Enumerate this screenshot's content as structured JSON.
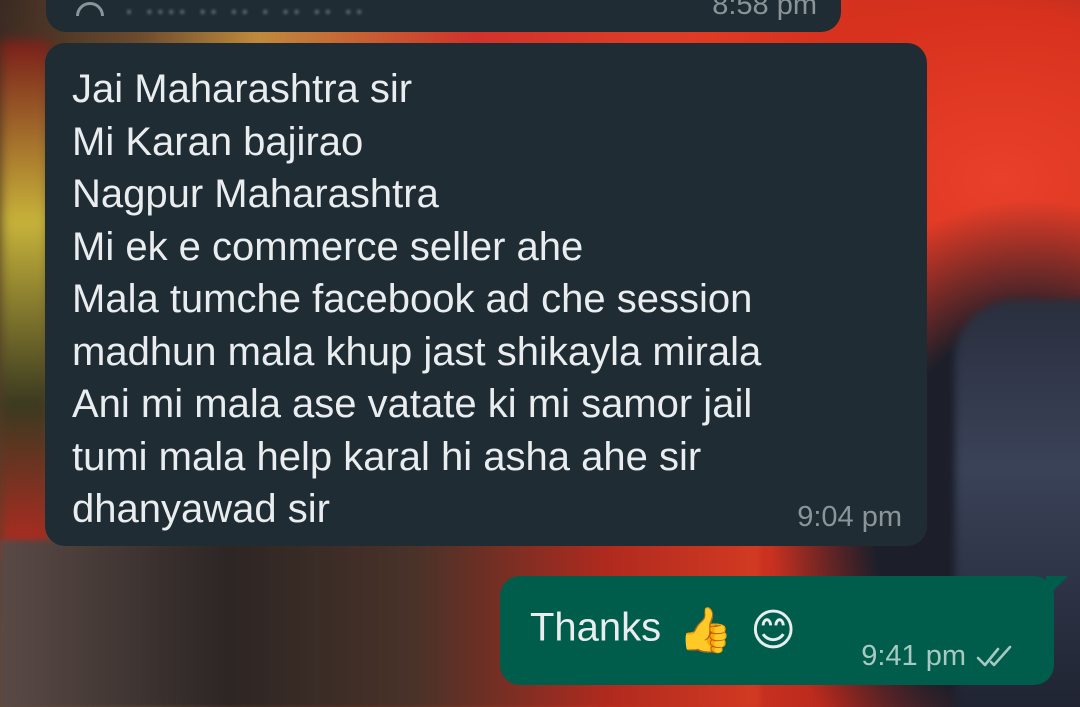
{
  "previous_message": {
    "partial_text": "·  ····  ·· ·· · ·· ·· ··",
    "time": "8:58 pm"
  },
  "incoming_message": {
    "lines": [
      "Jai Maharashtra sir",
      "Mi Karan bajirao",
      "Nagpur Maharashtra",
      "Mi ek e commerce seller ahe",
      "Mala tumche facebook ad che session",
      "madhun mala khup jast shikayla mirala",
      "Ani mi mala ase vatate ki mi samor jail",
      "tumi mala help karal hi asha ahe sir",
      "dhanyawad sir"
    ],
    "time": "9:04 pm"
  },
  "outgoing_message": {
    "text": "Thanks",
    "emojis": [
      "👍",
      "😊"
    ],
    "time": "9:41 pm",
    "status_icon": "double-check-icon",
    "status": "delivered"
  },
  "colors": {
    "incoming_bubble": "#1f2c33",
    "outgoing_bubble": "#005c4b",
    "message_text": "#e9edef",
    "timestamp": "#8a9499"
  }
}
